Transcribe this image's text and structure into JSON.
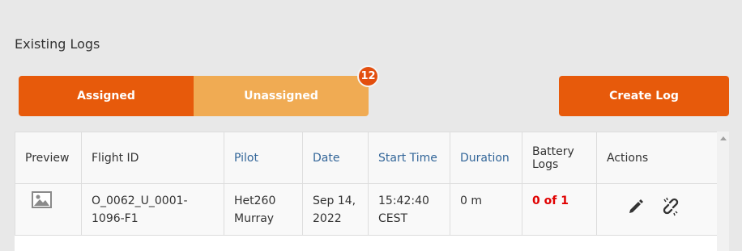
{
  "section_title": "Existing Logs",
  "tabs": {
    "assigned_label": "Assigned",
    "unassigned_label": "Unassigned",
    "unassigned_count": "12"
  },
  "create_button_label": "Create Log",
  "table": {
    "headers": {
      "preview": "Preview",
      "flight_id": "Flight ID",
      "pilot": "Pilot",
      "date": "Date",
      "start_time": "Start Time",
      "duration": "Duration",
      "battery_line1": "Battery",
      "battery_line2": "Logs",
      "actions": "Actions"
    },
    "rows": [
      {
        "flight_id_line1": "O_0062_U_0001-",
        "flight_id_line2": "1096-F1",
        "pilot_line1": "Het260",
        "pilot_line2": "Murray",
        "date_line1": "Sep 14,",
        "date_line2": "2022",
        "start_time_line1": "15:42:40",
        "start_time_line2": "CEST",
        "duration": "0 m",
        "battery_logs": "0 of 1"
      }
    ]
  },
  "icons": {
    "preview": "image-icon",
    "edit": "pencil-icon",
    "unlink": "unlink-icon"
  },
  "colors": {
    "primary_orange": "#e75a0b",
    "light_orange": "#f0ab53",
    "badge": "#e34f0f",
    "link_blue": "#336699",
    "error_red": "#e00000"
  }
}
